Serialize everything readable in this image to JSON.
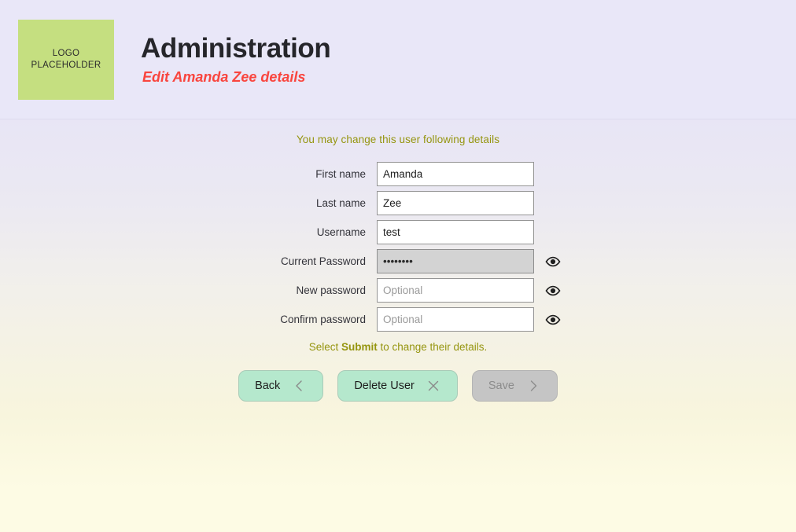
{
  "header": {
    "logo_line1": "LOGO",
    "logo_line2": "PLACEHOLDER",
    "title": "Administration",
    "subtitle": "Edit Amanda Zee details",
    "logo_color": "#c5df80",
    "subtitle_color": "#f9453e"
  },
  "content": {
    "hint": "You may change this user following details",
    "hint_color": "#95950f",
    "submit_note_prefix": "Select ",
    "submit_note_bold": "Submit",
    "submit_note_suffix": " to change their details."
  },
  "form": {
    "fields": [
      {
        "label": "First name",
        "value": "Amanda",
        "placeholder": "",
        "type": "text",
        "disabled": false,
        "has_eye": false
      },
      {
        "label": "Last name",
        "value": "Zee",
        "placeholder": "",
        "type": "text",
        "disabled": false,
        "has_eye": false
      },
      {
        "label": "Username",
        "value": "test",
        "placeholder": "",
        "type": "text",
        "disabled": false,
        "has_eye": false
      },
      {
        "label": "Current Password",
        "value": "••••••••",
        "placeholder": "",
        "type": "password",
        "disabled": true,
        "has_eye": true
      },
      {
        "label": "New password",
        "value": "",
        "placeholder": "Optional",
        "type": "password",
        "disabled": false,
        "has_eye": true
      },
      {
        "label": "Confirm password",
        "value": "",
        "placeholder": "Optional",
        "type": "password",
        "disabled": false,
        "has_eye": true
      }
    ],
    "eye_icon": "eye-icon"
  },
  "buttons": [
    {
      "label": "Back",
      "icon": "chevron-left-icon",
      "disabled": false
    },
    {
      "label": "Delete User",
      "icon": "close-x-icon",
      "disabled": false
    },
    {
      "label": "Save",
      "icon": "chevron-right-icon",
      "disabled": true
    }
  ],
  "colors": {
    "accent_green": "#b5e8cd",
    "disabled_gray": "#c5c5c5",
    "olive": "#95950f",
    "red": "#f9453e",
    "logo_green": "#c5df80",
    "bg_top": "#e8e5f8",
    "bg_bottom": "#fdfbe4"
  }
}
